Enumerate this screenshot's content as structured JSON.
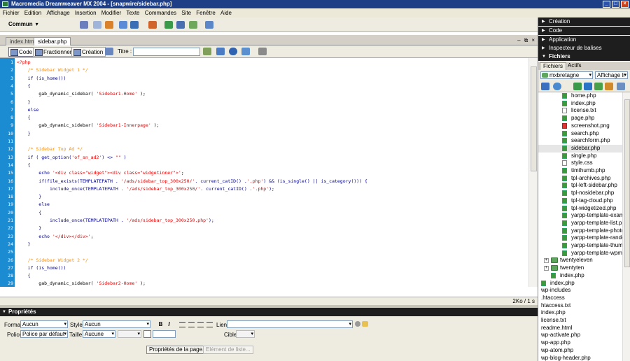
{
  "window": {
    "title": "Macromedia Dreamweaver MX 2004 - [snapwire/sidebar.php]",
    "controls": [
      "_",
      "□",
      "×"
    ]
  },
  "menu": [
    "Fichier",
    "Edition",
    "Affichage",
    "Insertion",
    "Modifier",
    "Texte",
    "Commandes",
    "Site",
    "Fenêtre",
    "Aide"
  ],
  "insert_bar": {
    "category": "Commun"
  },
  "doc_tabs": [
    "index.html",
    "sidebar.php"
  ],
  "doc_window_controls": [
    "–",
    "⧉",
    "×"
  ],
  "doc_toolbar": {
    "code": "Code",
    "split": "Fractionner",
    "design": "Création",
    "title_label": "Titre :",
    "title_value": ""
  },
  "code_lines": [
    [
      {
        "t": "<?php",
        "c": "php"
      }
    ],
    [
      {
        "t": "    /* Sidebar Widget 1 */",
        "c": "cm"
      }
    ],
    [
      {
        "t": "    if (is_home())",
        "c": "kw"
      }
    ],
    [
      {
        "t": "    {",
        "c": "kw"
      }
    ],
    [
      {
        "t": "        gab_dynamic_sidebar( ",
        "c": "plain"
      },
      {
        "t": "'Sidebar1-Home'",
        "c": "str"
      },
      {
        "t": " );",
        "c": "plain"
      }
    ],
    [
      {
        "t": "    }",
        "c": "kw"
      }
    ],
    [
      {
        "t": "    else",
        "c": "kw"
      }
    ],
    [
      {
        "t": "    {",
        "c": "kw"
      }
    ],
    [
      {
        "t": "        gab_dynamic_sidebar( ",
        "c": "plain"
      },
      {
        "t": "'Sidebar1-Innerpage'",
        "c": "str"
      },
      {
        "t": " );",
        "c": "plain"
      }
    ],
    [
      {
        "t": "    }",
        "c": "kw"
      }
    ],
    [],
    [
      {
        "t": "    /* Sidebar Top Ad */",
        "c": "cm"
      }
    ],
    [
      {
        "t": "    if ( get_option(",
        "c": "kw"
      },
      {
        "t": "'of_sn_ad2'",
        "c": "str"
      },
      {
        "t": ") <> ",
        "c": "kw"
      },
      {
        "t": "\"\"",
        "c": "str"
      },
      {
        "t": " )",
        "c": "kw"
      }
    ],
    [
      {
        "t": "    {",
        "c": "kw"
      }
    ],
    [
      {
        "t": "        echo ",
        "c": "kw"
      },
      {
        "t": "'<div class=\"widget\"><div class=\"widgetinner\">'",
        "c": "str"
      },
      {
        "t": ";",
        "c": "plain"
      }
    ],
    [
      {
        "t": "        if(file_exists(TEMPLATEPATH . ",
        "c": "kw"
      },
      {
        "t": "'/ads/sidebar_top_300x250/'",
        "c": "str"
      },
      {
        "t": ". current_catID() .",
        "c": "kw"
      },
      {
        "t": "'.php'",
        "c": "str"
      },
      {
        "t": ") && (is_single() || is_category())) {",
        "c": "kw"
      }
    ],
    [
      {
        "t": "            include_once(TEMPLATEPATH . ",
        "c": "kw"
      },
      {
        "t": "'/ads/sidebar_top_300x250/'",
        "c": "str"
      },
      {
        "t": ". current_catID() .",
        "c": "kw"
      },
      {
        "t": "'.php'",
        "c": "str"
      },
      {
        "t": ");",
        "c": "kw"
      }
    ],
    [
      {
        "t": "        }",
        "c": "kw"
      }
    ],
    [
      {
        "t": "        else",
        "c": "kw"
      }
    ],
    [
      {
        "t": "        {",
        "c": "kw"
      }
    ],
    [
      {
        "t": "            include_once(TEMPLATEPATH . ",
        "c": "kw"
      },
      {
        "t": "'/ads/sidebar_top_300x250.php'",
        "c": "str"
      },
      {
        "t": ");",
        "c": "kw"
      }
    ],
    [
      {
        "t": "        }",
        "c": "kw"
      }
    ],
    [
      {
        "t": "        echo ",
        "c": "kw"
      },
      {
        "t": "'</div></div>'",
        "c": "str"
      },
      {
        "t": ";",
        "c": "plain"
      }
    ],
    [
      {
        "t": "    }",
        "c": "kw"
      }
    ],
    [],
    [
      {
        "t": "    /* Sidebar Widget 2 */",
        "c": "cm"
      }
    ],
    [
      {
        "t": "    if (is_home())",
        "c": "kw"
      }
    ],
    [
      {
        "t": "    {",
        "c": "kw"
      }
    ],
    [
      {
        "t": "        gab_dynamic_sidebar( ",
        "c": "plain"
      },
      {
        "t": "'Sidebar2-Home'",
        "c": "str"
      },
      {
        "t": " );",
        "c": "plain"
      }
    ]
  ],
  "status": {
    "size": "2Ko / 1 s"
  },
  "props": {
    "title": "Propriétés",
    "format_label": "Format",
    "format_value": "Aucun",
    "style_label": "Style",
    "style_value": "Aucun",
    "bold": "B",
    "italic": "I",
    "link_label": "Lien",
    "font_label": "Police",
    "font_value": "Police par défaut",
    "size_label": "Taille",
    "size_value": "Aucune",
    "target_label": "Cible",
    "page_props_button": "Propriétés de la page...",
    "list_item_button": "Elément de liste..."
  },
  "panels": {
    "creation": "Création",
    "code": "Code",
    "application": "Application",
    "tag_inspector": "Inspecteur de balises",
    "files": "Fichiers"
  },
  "files_tabs": [
    "Fichiers",
    "Actifs"
  ],
  "files_site": "mxbretagne",
  "files_view": "Affichage li",
  "tree": [
    {
      "name": "home.php",
      "type": "php",
      "indent": 2
    },
    {
      "name": "index.php",
      "type": "php",
      "indent": 2
    },
    {
      "name": "license.txt",
      "type": "txt",
      "indent": 2
    },
    {
      "name": "page.php",
      "type": "php",
      "indent": 2
    },
    {
      "name": "screenshot.png",
      "type": "img",
      "indent": 2
    },
    {
      "name": "search.php",
      "type": "php",
      "indent": 2
    },
    {
      "name": "searchform.php",
      "type": "php",
      "indent": 2
    },
    {
      "name": "sidebar.php",
      "type": "php",
      "indent": 2,
      "selected": true
    },
    {
      "name": "single.php",
      "type": "php",
      "indent": 2
    },
    {
      "name": "style.css",
      "type": "txt",
      "indent": 2
    },
    {
      "name": "timthumb.php",
      "type": "php",
      "indent": 2
    },
    {
      "name": "tpl-archives.php",
      "type": "php",
      "indent": 2
    },
    {
      "name": "tpl-left-sidebar.php",
      "type": "php",
      "indent": 2
    },
    {
      "name": "tpl-nosidebar.php",
      "type": "php",
      "indent": 2
    },
    {
      "name": "tpl-tag-cloud.php",
      "type": "php",
      "indent": 2
    },
    {
      "name": "tpl-widgetized.php",
      "type": "php",
      "indent": 2
    },
    {
      "name": "yarpp-template-example",
      "type": "php",
      "indent": 2
    },
    {
      "name": "yarpp-template-list.php",
      "type": "php",
      "indent": 2
    },
    {
      "name": "yarpp-template-photobl",
      "type": "php",
      "indent": 2
    },
    {
      "name": "yarpp-template-random",
      "type": "php",
      "indent": 2
    },
    {
      "name": "yarpp-template-thumbn",
      "type": "php",
      "indent": 2
    },
    {
      "name": "yarpp-template-wpml.ph",
      "type": "php",
      "indent": 2
    },
    {
      "name": "twentyeleven",
      "type": "folder",
      "indent": 1
    },
    {
      "name": "twentyten",
      "type": "folder",
      "indent": 1
    },
    {
      "name": "index.php",
      "type": "php",
      "indent": 1
    },
    {
      "name": "index.php",
      "type": "php",
      "indent": 0
    },
    {
      "name": "wp-includes",
      "type": "none",
      "indent": 0
    },
    {
      "name": ".htaccess",
      "type": "none",
      "indent": 0
    },
    {
      "name": "htaccess.txt",
      "type": "none",
      "indent": 0
    },
    {
      "name": "index.php",
      "type": "none",
      "indent": 0
    },
    {
      "name": "license.txt",
      "type": "none",
      "indent": 0
    },
    {
      "name": "readme.html",
      "type": "none",
      "indent": 0
    },
    {
      "name": "wp-activate.php",
      "type": "none",
      "indent": 0
    },
    {
      "name": "wp-app.php",
      "type": "none",
      "indent": 0
    },
    {
      "name": "wp-atom.php",
      "type": "none",
      "indent": 0
    },
    {
      "name": "wp-blog-header.php",
      "type": "none",
      "indent": 0
    }
  ]
}
